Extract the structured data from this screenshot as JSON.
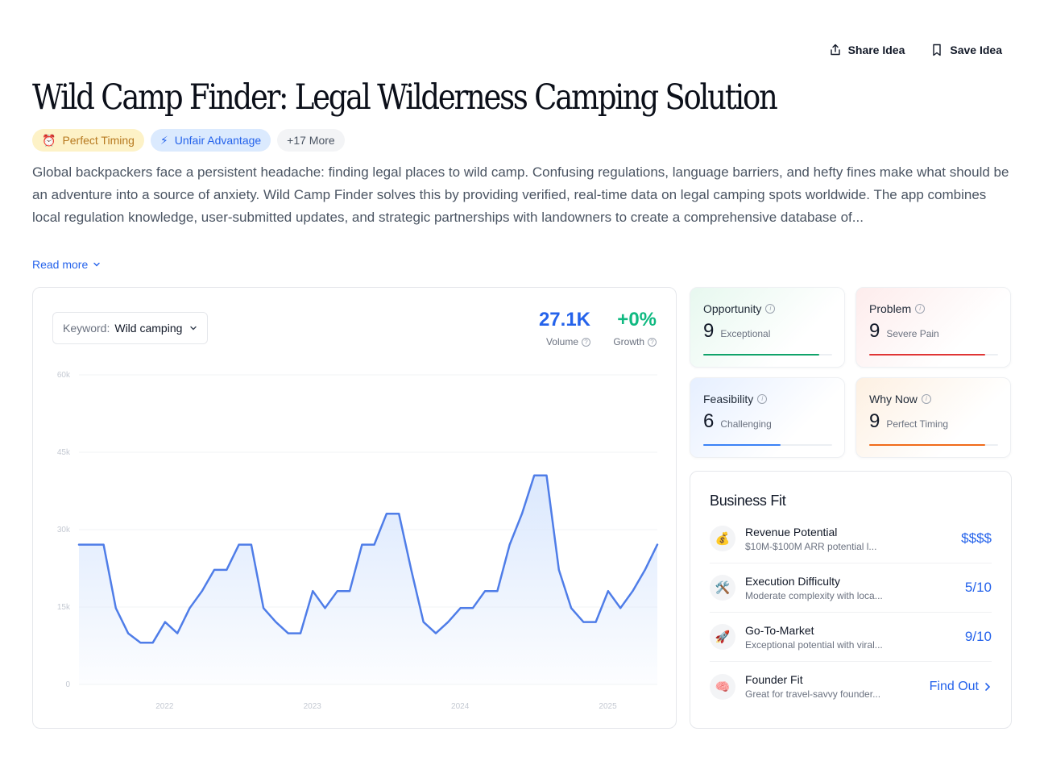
{
  "actions": {
    "share_label": "Share Idea",
    "save_label": "Save Idea"
  },
  "title": "Wild Camp Finder: Legal Wilderness Camping Solution",
  "tags": [
    {
      "icon": "alarm-clock-icon",
      "glyph": "⏰",
      "label": "Perfect Timing"
    },
    {
      "icon": "lightning-icon",
      "glyph": "⚡",
      "label": "Unfair Advantage"
    },
    {
      "label": "+17 More"
    }
  ],
  "description": "Global backpackers face a persistent headache: finding legal places to wild camp. Confusing regulations, language barriers, and hefty fines make what should be an adventure into a source of anxiety. Wild Camp Finder solves this by providing verified, real-time data on legal camping spots worldwide. The app combines local regulation knowledge, user-submitted updates, and strategic partnerships with landowners to create a comprehensive database of...",
  "read_more": "Read more",
  "keyword": {
    "label": "Keyword:",
    "value": "Wild camping"
  },
  "metrics": {
    "volume": {
      "value": "27.1K",
      "label": "Volume"
    },
    "growth": {
      "value": "+0%",
      "label": "Growth"
    }
  },
  "chart_data": {
    "type": "area",
    "ylim": [
      0,
      60000
    ],
    "yticks": [
      "0",
      "15k",
      "30k",
      "45k",
      "60k"
    ],
    "xticks": [
      {
        "label": "2022",
        "x": 2022.0
      },
      {
        "label": "2023",
        "x": 2023.0
      },
      {
        "label": "2024",
        "x": 2024.0
      },
      {
        "label": "2025",
        "x": 2025.0
      }
    ],
    "x_start": 2021.42,
    "x_step": 0.0833,
    "values": [
      27100,
      27100,
      27100,
      14800,
      9900,
      8100,
      8100,
      12100,
      9900,
      14800,
      18100,
      22200,
      22200,
      27100,
      27100,
      14800,
      12100,
      9900,
      9900,
      18100,
      14800,
      18100,
      18100,
      27100,
      27100,
      33100,
      33100,
      22200,
      12100,
      9900,
      12100,
      14800,
      14800,
      18100,
      18100,
      27100,
      33100,
      40500,
      40500,
      22200,
      14800,
      12100,
      12100,
      18100,
      14800,
      18100,
      22200,
      27100
    ],
    "line_color": "#4f7de8",
    "fill_color": "#dbe8fd",
    "grid": true
  },
  "scores": [
    {
      "key": "opp",
      "label": "Opportunity",
      "value": "9",
      "sub": "Exceptional",
      "fill": 0.9,
      "color": "#10a36a"
    },
    {
      "key": "prob",
      "label": "Problem",
      "value": "9",
      "sub": "Severe Pain",
      "fill": 0.9,
      "color": "#e03535"
    },
    {
      "key": "feas",
      "label": "Feasibility",
      "value": "6",
      "sub": "Challenging",
      "fill": 0.6,
      "color": "#3b82f6"
    },
    {
      "key": "why",
      "label": "Why Now",
      "value": "9",
      "sub": "Perfect Timing",
      "fill": 0.9,
      "color": "#f06b1a"
    }
  ],
  "business_fit": {
    "title": "Business Fit",
    "rows": [
      {
        "icon": "money-bag-icon",
        "glyph": "💰",
        "name": "Revenue Potential",
        "desc": "$10M-$100M ARR potential l...",
        "value": "$$$$"
      },
      {
        "icon": "tools-icon",
        "glyph": "🛠️",
        "name": "Execution Difficulty",
        "desc": "Moderate complexity with loca...",
        "value": "5/10"
      },
      {
        "icon": "rocket-icon",
        "glyph": "🚀",
        "name": "Go-To-Market",
        "desc": "Exceptional potential with viral...",
        "value": "9/10"
      },
      {
        "icon": "brain-icon",
        "glyph": "🧠",
        "name": "Founder Fit",
        "desc": "Great for travel-savvy founder...",
        "value": "Find Out"
      }
    ]
  }
}
